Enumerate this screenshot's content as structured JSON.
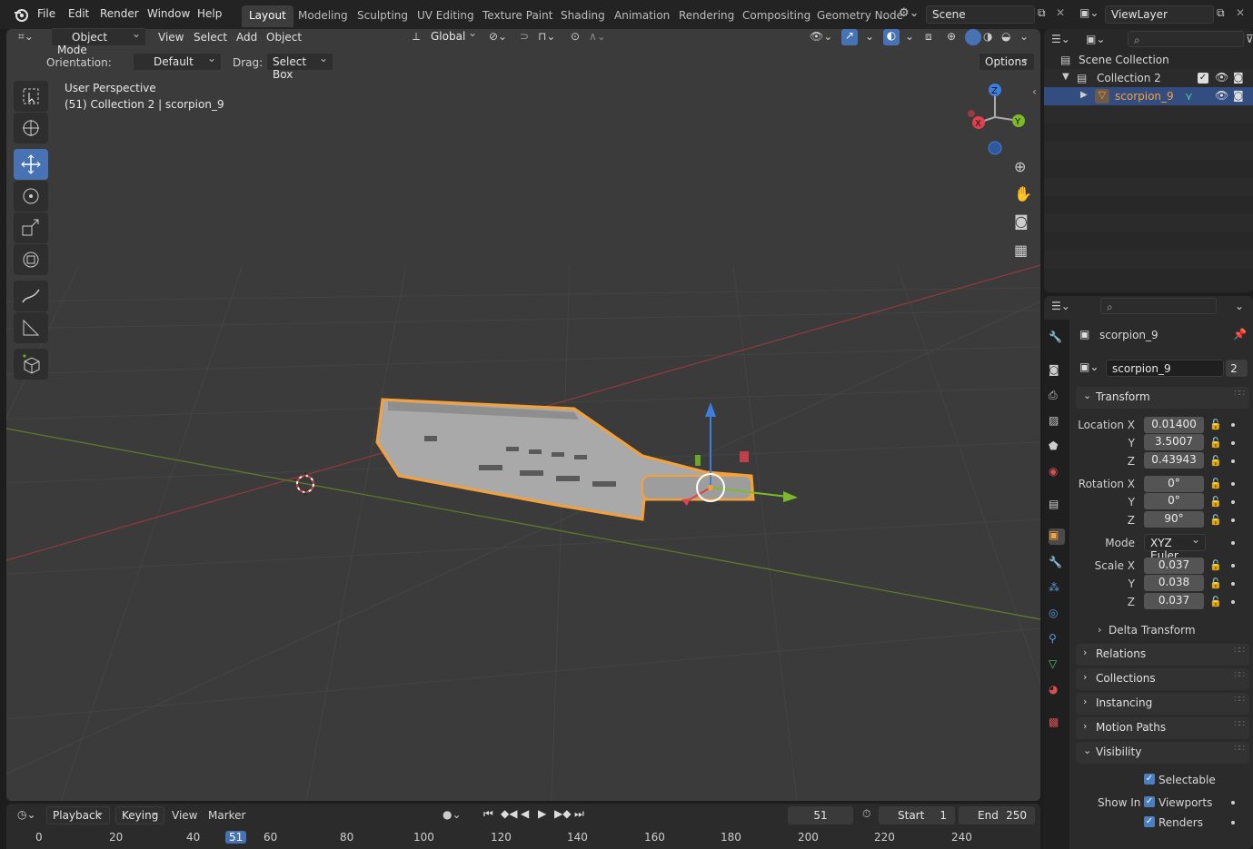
{
  "menubar": {
    "items": [
      "File",
      "Edit",
      "Render",
      "Window",
      "Help"
    ]
  },
  "workspaces": {
    "tabs": [
      "Layout",
      "Modeling",
      "Sculpting",
      "UV Editing",
      "Texture Paint",
      "Shading",
      "Animation",
      "Rendering",
      "Compositing",
      "Geometry Node"
    ],
    "active": "Layout"
  },
  "scene": {
    "name": "Scene"
  },
  "viewlayer": {
    "name": "ViewLayer"
  },
  "viewport_header": {
    "mode": "Object Mode",
    "view": "View",
    "select": "Select",
    "add": "Add",
    "object": "Object",
    "transform_orientation": "Global",
    "options": "Options"
  },
  "tool_settings": {
    "orientation_label": "Orientation:",
    "orientation_value": "Default",
    "drag_label": "Drag:",
    "drag_value": "Select Box"
  },
  "viewport": {
    "perspective": "User Perspective",
    "info": "(51) Collection 2 | scorpion_9",
    "gizmo_axes": [
      "X",
      "Y",
      "Z"
    ]
  },
  "timeline": {
    "playback": "Playback",
    "keying": "Keying",
    "view": "View",
    "marker": "Marker",
    "current_frame": "51",
    "start_label": "Start",
    "start": "1",
    "end_label": "End",
    "end": "250",
    "ruler": [
      "0",
      "20",
      "40",
      "51",
      "60",
      "80",
      "100",
      "120",
      "140",
      "160",
      "180",
      "200",
      "220",
      "240"
    ]
  },
  "outliner": {
    "root": "Scene Collection",
    "collection": "Collection 2",
    "object": "scorpion_9"
  },
  "properties": {
    "object_name": "scorpion_9",
    "data_name": "scorpion_9",
    "users": "2",
    "transform_label": "Transform",
    "location_label": "Location X",
    "location": {
      "x": "0.01400",
      "y": "3.5007",
      "z": "0.43943"
    },
    "rotation_label": "Rotation X",
    "rotation": {
      "x": "0°",
      "y": "0°",
      "z": "90°"
    },
    "mode_label": "Mode",
    "mode": "XYZ Euler",
    "scale_label": "Scale X",
    "scale": {
      "x": "0.037",
      "y": "0.038",
      "z": "0.037"
    },
    "axis_y": "Y",
    "axis_z": "Z",
    "delta_transform": "Delta Transform",
    "relations": "Relations",
    "collections": "Collections",
    "instancing": "Instancing",
    "motion_paths": "Motion Paths",
    "visibility": "Visibility",
    "selectable": "Selectable",
    "show_in_label": "Show In",
    "viewports": "Viewports",
    "renders": "Renders"
  },
  "colors": {
    "accent": "#4772b3",
    "selection_outline": "#f5a13a",
    "axis_x": "#e0414f",
    "axis_y": "#7cba2a",
    "axis_z": "#3d7fe0"
  }
}
